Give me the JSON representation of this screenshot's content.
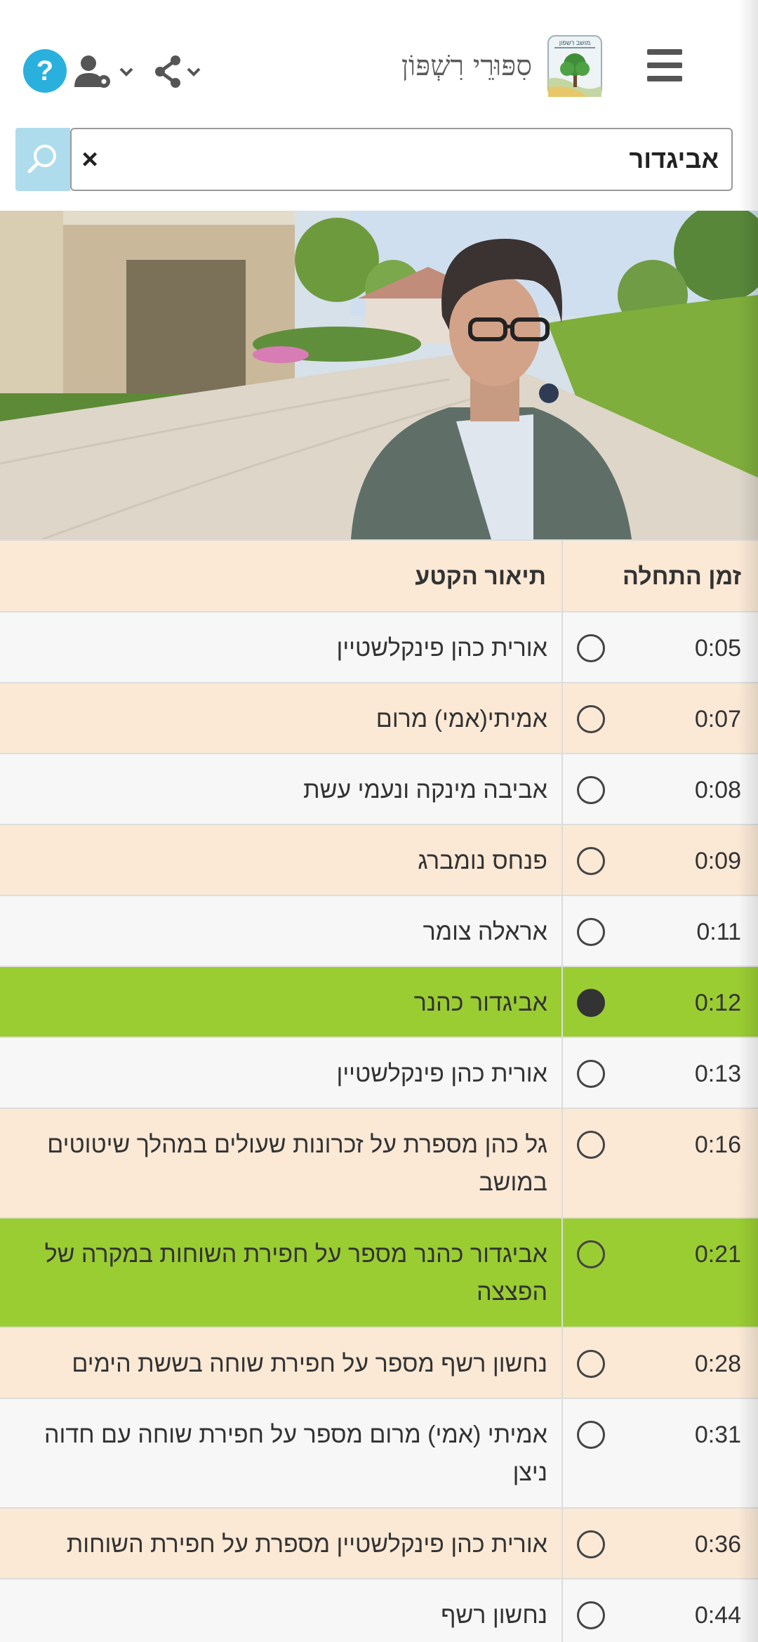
{
  "header": {
    "site_title": "סִפּוּרֵי רִשְׁפּוֹן",
    "logo_text": "מושב רשפון",
    "icons": [
      "menu-icon",
      "help-icon",
      "user-settings-icon",
      "share-icon"
    ],
    "help_label": "?"
  },
  "search": {
    "value": "אביגדור",
    "clear_label": "×",
    "icon": "search-icon"
  },
  "table": {
    "headers": {
      "time": "זמן התחלה",
      "description": "תיאור הקטע"
    },
    "rows": [
      {
        "time": "0:05",
        "description": "אורית כהן פינקלשטיין",
        "selected": false,
        "highlighted": false
      },
      {
        "time": "0:07",
        "description": "אמיתי(אמי) מרום",
        "selected": false,
        "highlighted": false
      },
      {
        "time": "0:08",
        "description": "אביבה מינקה ונעמי עשת",
        "selected": false,
        "highlighted": false
      },
      {
        "time": "0:09",
        "description": "פנחס נומברג",
        "selected": false,
        "highlighted": false
      },
      {
        "time": "0:11",
        "description": "אראלה צומר",
        "selected": false,
        "highlighted": false
      },
      {
        "time": "0:12",
        "description": "אביגדור כהנר",
        "selected": true,
        "highlighted": true
      },
      {
        "time": "0:13",
        "description": "אורית כהן פינקלשטיין",
        "selected": false,
        "highlighted": false
      },
      {
        "time": "0:16",
        "description": "גל כהן מספרת על זכרונות שעולים במהלך שיטוטים במושב",
        "selected": false,
        "highlighted": false
      },
      {
        "time": "0:21",
        "description": "אביגדור כהנר מספר על חפירת השוחות במקרה של הפצצה",
        "selected": false,
        "highlighted": true
      },
      {
        "time": "0:28",
        "description": "נחשון רשף מספר על חפירת שוחה בששת הימים",
        "selected": false,
        "highlighted": false
      },
      {
        "time": "0:31",
        "description": "אמיתי (אמי) מרום מספר על חפירת שוחה עם חדוה ניצן",
        "selected": false,
        "highlighted": false
      },
      {
        "time": "0:36",
        "description": "אורית כהן פינקלשטיין מספרת על חפירת השוחות",
        "selected": false,
        "highlighted": false
      },
      {
        "time": "0:44",
        "description": "נחשון רשף",
        "selected": false,
        "highlighted": false
      }
    ]
  },
  "colors": {
    "row_odd": "#f7f7f7",
    "row_even": "#fbe9d6",
    "row_highlight": "#9acd32",
    "help_button": "#2ab0dc",
    "search_button": "#aedcec"
  }
}
